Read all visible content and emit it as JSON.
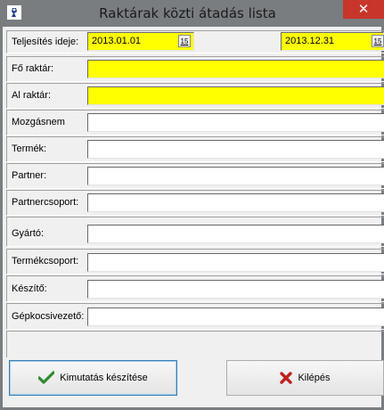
{
  "window": {
    "title": "Raktárak közti átadás lista",
    "close_glyph": "✕",
    "icon": "app-icon"
  },
  "period": {
    "label": "Teljesítés ideje:",
    "from": "2013.01.01",
    "to": "2013.12.31",
    "calendar_glyph": "15"
  },
  "fields": [
    {
      "label": "Fő raktár:",
      "required": true
    },
    {
      "label": "Al raktár:",
      "required": true
    },
    {
      "label": "Mozgásnem",
      "required": false
    },
    {
      "label": "Termék:",
      "required": false
    },
    {
      "label": "Partner:",
      "required": false
    },
    {
      "label": "Partnercsoport:",
      "required": false
    },
    {
      "label": "Gyártó:",
      "required": false
    },
    {
      "label": "Termékcsoport:",
      "required": false
    },
    {
      "label": "Készítő:",
      "required": false
    },
    {
      "label": "Gépkocsivezető:",
      "required": false
    }
  ],
  "buttons": {
    "report": {
      "label": "Kimutatás készítése",
      "icon": "checkmark-icon"
    },
    "exit": {
      "label": "Kilépés",
      "icon": "x-mark-icon"
    }
  },
  "colors": {
    "required_field": "#ffff00",
    "check_icon": "#2e8b2e",
    "exit_icon": "#c02020"
  }
}
